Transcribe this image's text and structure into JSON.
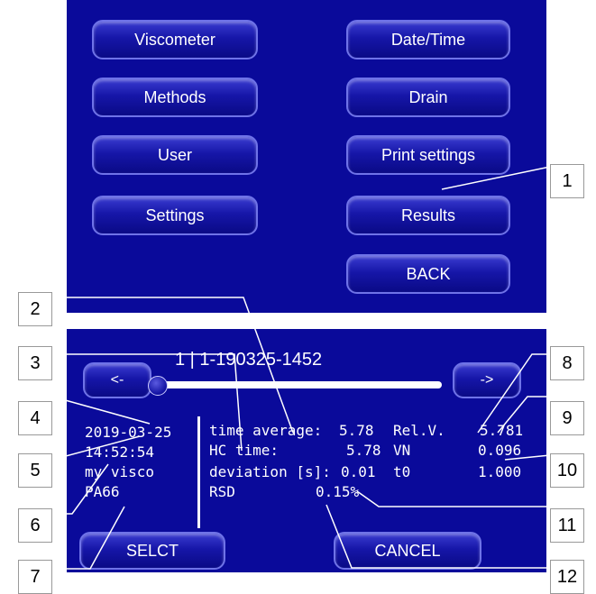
{
  "menu": {
    "viscometer": "Viscometer",
    "date_time": "Date/Time",
    "methods": "Methods",
    "drain": "Drain",
    "user": "User",
    "print_settings": "Print settings",
    "settings": "Settings",
    "results": "Results",
    "back": "BACK"
  },
  "results": {
    "header": "1 | 1-190325-1452",
    "prev": "<-",
    "next": "->",
    "date": "2019-03-25",
    "time": "14:52:54",
    "method": "my visco",
    "sample": "PA66",
    "rows": [
      {
        "label": "time average:",
        "value": "5.78",
        "label2": "Rel.V.",
        "value2": "5.781"
      },
      {
        "label": "HC time:",
        "value": "5.78",
        "label2": "VN",
        "value2": "0.096"
      },
      {
        "label": "deviation [s]:",
        "value": "0.01",
        "label2": "t0",
        "value2": "1.000"
      },
      {
        "label": "RSD",
        "value": "0.15%"
      }
    ],
    "select": "SELCT",
    "cancel": "CANCEL",
    "slider_position": 0.0
  },
  "callouts": [
    "1",
    "2",
    "3",
    "4",
    "5",
    "6",
    "7",
    "8",
    "9",
    "10",
    "11",
    "12"
  ],
  "colors": {
    "panel": "#0a0a9a",
    "button": "#1616a8",
    "text": "#ffffff"
  }
}
